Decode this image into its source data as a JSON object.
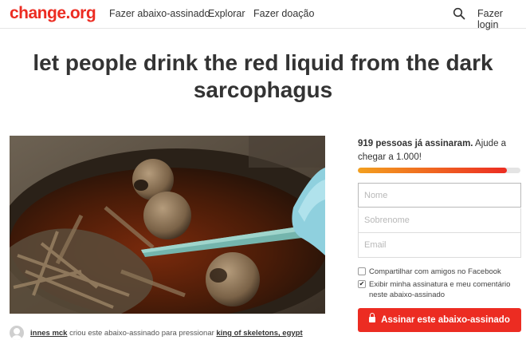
{
  "header": {
    "logo": "change.org",
    "nav": [
      "Fazer abaixo-assinado",
      "Explorar",
      "Fazer doação"
    ],
    "login": "Fazer login"
  },
  "petition": {
    "title": "let people drink the red liquid from the dark sarcophagus",
    "creator": {
      "name": "innes mck",
      "action": " criou este abaixo-assinado para pressionar ",
      "target": "king of skeletons, egypt"
    }
  },
  "signature": {
    "count_bold": "919 pessoas já assinaram.",
    "count_rest": " Ajude a chegar a 1.000!",
    "progress": 0.919,
    "fields": {
      "first_name_placeholder": "Nome",
      "last_name_placeholder": "Sobrenome",
      "email_placeholder": "Email"
    },
    "share_facebook_label": "Compartilhar com amigos no Facebook",
    "display_signature_label": "Exibir minha assinatura e meu comentário neste abaixo-assinado",
    "share_facebook_checked": false,
    "display_signature_checked": true,
    "sign_button": "Assinar este abaixo-assinado"
  },
  "colors": {
    "brand": "#ec2c22",
    "progress_start": "#f3a01f"
  },
  "icons": {
    "search": "search-icon",
    "lock": "lock-icon",
    "check": "✔"
  }
}
